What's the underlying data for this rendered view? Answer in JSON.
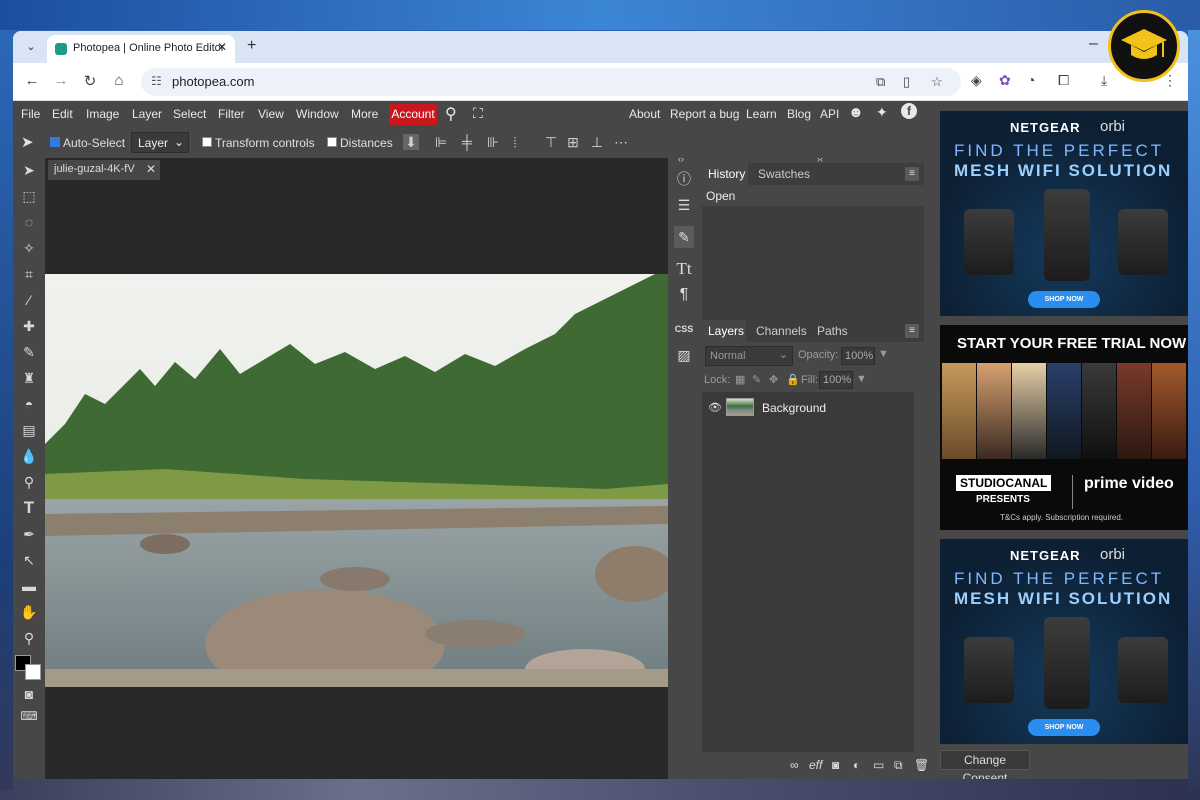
{
  "browser": {
    "tab_title": "Photopea | Online Photo Editor",
    "url": "photopea.com"
  },
  "menubar": {
    "items": [
      "File",
      "Edit",
      "Image",
      "Layer",
      "Select",
      "Filter",
      "View",
      "Window",
      "More"
    ],
    "account": "Account",
    "right_items": [
      "About",
      "Report a bug",
      "Learn",
      "Blog",
      "API"
    ]
  },
  "options": {
    "auto_select": "Auto-Select",
    "auto_select_checked": true,
    "layer_select": "Layer",
    "transform_controls": "Transform controls",
    "distances": "Distances"
  },
  "document": {
    "tab_name": "julie-guzal-4K-fV",
    "canvas_description_colors": [
      "#e9ebe6",
      "#3f6e3a",
      "#7d8a8c",
      "#a59a8a"
    ]
  },
  "history_panel": {
    "tabs": [
      "History",
      "Swatches"
    ],
    "items": [
      "Open"
    ]
  },
  "layers_panel": {
    "tabs": [
      "Layers",
      "Channels",
      "Paths"
    ],
    "blend_mode": "Normal",
    "opacity_label": "Opacity:",
    "opacity_value": "100%",
    "lock_label": "Lock:",
    "fill_label": "Fill:",
    "fill_value": "100%",
    "layers": [
      "Background"
    ],
    "bottom_icons": [
      "link-icon",
      "effects-icon",
      "mask-icon",
      "adjustment-icon",
      "folder-icon",
      "new-layer-icon",
      "trash-icon"
    ],
    "effects_label": "eff"
  },
  "ads": {
    "netgear": {
      "brand": "NETGEAR",
      "sub": "orbi",
      "line1": "FIND THE PERFECT",
      "line2": "MESH WIFI SOLUTION",
      "button": "SHOP NOW"
    },
    "studiocanal": {
      "headline": "START YOUR FREE TRIAL NOW",
      "logo": "STUDIOCANAL",
      "presents": "PRESENTS",
      "partner": "prime video",
      "terms": "T&Cs apply. Subscription required."
    },
    "consent_button": "Change Consent"
  },
  "colors": {
    "accent_account": "#c8171d",
    "app_bg": "#474747",
    "canvas_bg": "#282828"
  }
}
